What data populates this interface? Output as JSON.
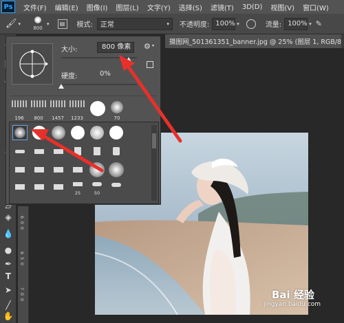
{
  "app": {
    "logo": "Ps"
  },
  "menu": [
    "文件(F)",
    "编辑(E)",
    "图像(I)",
    "图层(L)",
    "文字(Y)",
    "选择(S)",
    "滤镜(T)",
    "3D(D)",
    "视图(V)",
    "窗口(W)"
  ],
  "options": {
    "brush_size_num": "800",
    "mode_label": "模式:",
    "mode_value": "正常",
    "opacity_label": "不透明度:",
    "opacity_value": "100%",
    "flow_label": "流量:",
    "flow_value": "100%"
  },
  "document_tab": {
    "title": "摄图网_501361351_banner.jpg @ 25% (图层 1, RGB/8) *"
  },
  "brush_panel": {
    "size_label": "大小:",
    "size_value": "800 像素",
    "size_fraction": 0.93,
    "hardness_label": "硬度:",
    "hardness_value": "0%",
    "hardness_fraction": 0.0,
    "recent_brushes": [
      {
        "size": "196"
      },
      {
        "size": "800"
      },
      {
        "size": "1457"
      },
      {
        "size": "1233"
      },
      {
        "size": ""
      },
      {
        "size": "70"
      }
    ],
    "grid_numbers": [
      "25",
      "50"
    ]
  },
  "ruler": {
    "marks": [
      "6",
      "0",
      "0",
      "6",
      "5",
      "0",
      "7",
      "0",
      "0"
    ]
  },
  "watermark": {
    "brand": "Bai 经验",
    "url": "jingyan.baidu.com"
  },
  "colors": {
    "accent": "#31a8ff",
    "arrow": "#e8302a",
    "panel": "#535353",
    "workspace": "#282828"
  },
  "icons": [
    "ps-logo-icon",
    "brush-tool-icon",
    "brush-preset-icon",
    "gear-icon",
    "airbrush-icon",
    "pressure-icon"
  ]
}
